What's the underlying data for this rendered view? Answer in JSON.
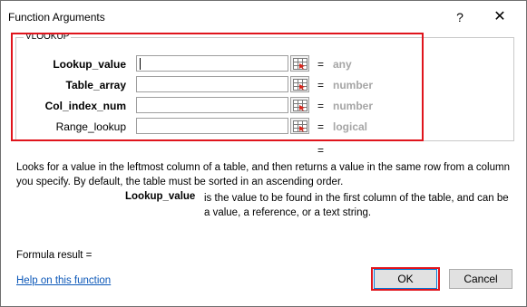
{
  "window": {
    "title": "Function Arguments",
    "help_glyph": "?",
    "close_glyph": "✕"
  },
  "group": {
    "legend": "VLOOKUP",
    "arguments": [
      {
        "label": "Lookup_value",
        "value": "",
        "equals": "=",
        "type": "any",
        "bold": true
      },
      {
        "label": "Table_array",
        "value": "",
        "equals": "=",
        "type": "number",
        "bold": true
      },
      {
        "label": "Col_index_num",
        "value": "",
        "equals": "=",
        "type": "number",
        "bold": true
      },
      {
        "label": "Range_lookup",
        "value": "",
        "equals": "=",
        "type": "logical",
        "bold": false
      }
    ],
    "result_equals": "="
  },
  "description": "Looks for a value in the leftmost column of a table, and then returns a value in the same row from a column you specify. By default, the table must be sorted in an ascending order.",
  "arg_help": {
    "name": "Lookup_value",
    "text": "is the value to be found in the first column of the table, and can be a value, a reference, or a text string."
  },
  "formula_result_label": "Formula result =",
  "help_link": "Help on this function",
  "buttons": {
    "ok": "OK",
    "cancel": "Cancel"
  },
  "colors": {
    "highlight": "#e0141c",
    "link": "#0b57b8",
    "type_text": "#a6a6a6"
  }
}
